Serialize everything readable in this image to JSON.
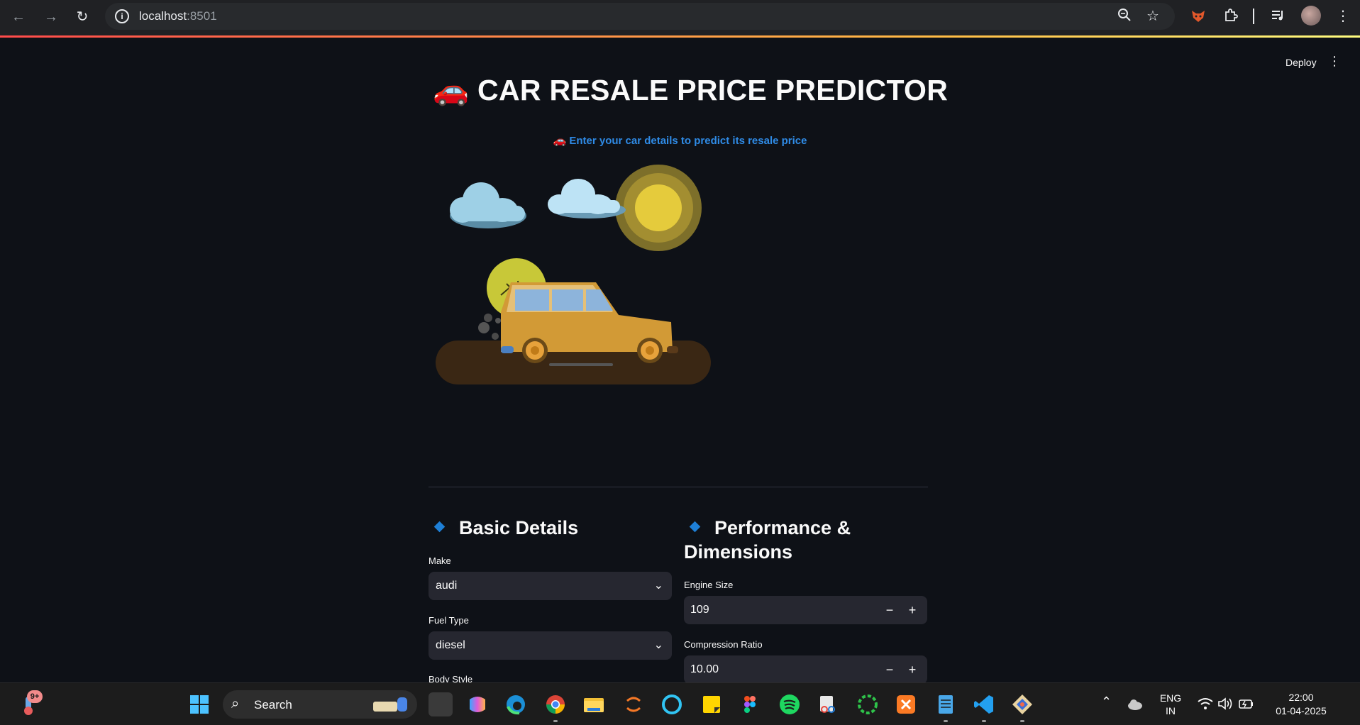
{
  "browser": {
    "url_host": "localhost",
    "url_port": ":8501"
  },
  "app": {
    "deploy_label": "Deploy",
    "title": "🚗 CAR RESALE PRICE PREDICTOR",
    "subtitle": "🚗 Enter your car details to predict its resale price"
  },
  "basic": {
    "heading": "Basic Details",
    "make_label": "Make",
    "make_value": "audi",
    "fuel_label": "Fuel Type",
    "fuel_value": "diesel",
    "body_label": "Body Style"
  },
  "performance": {
    "heading_line1": "Performance &",
    "heading_line2": "Dimensions",
    "engine_label": "Engine Size",
    "engine_value": "109",
    "compression_label": "Compression Ratio",
    "compression_value": "10.00"
  },
  "taskbar": {
    "search_label": "Search",
    "notification_badge": "9+",
    "lang_line1": "ENG",
    "lang_line2": "IN",
    "time": "22:00",
    "date": "01-04-2025"
  },
  "colors": {
    "accent_blue": "#2f8be6",
    "background": "#0e1117",
    "input_bg": "#262730"
  }
}
